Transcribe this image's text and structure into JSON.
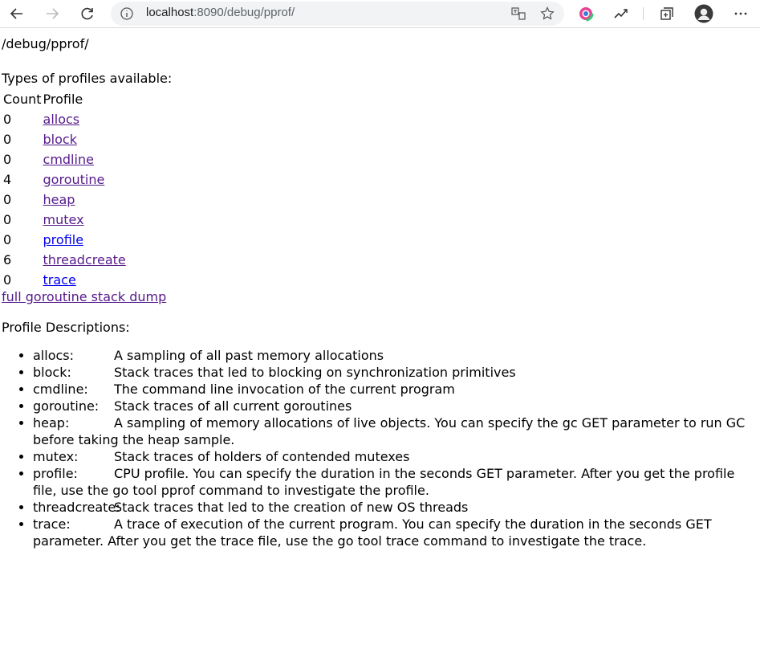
{
  "browser": {
    "url_host": "localhost",
    "url_path": ":8090/debug/pprof/"
  },
  "page": {
    "path_heading": "/debug/pprof/",
    "types_heading": "Types of profiles available:",
    "table": {
      "headers": [
        "Count",
        "Profile"
      ],
      "rows": [
        {
          "count": "0",
          "profile": "allocs"
        },
        {
          "count": "0",
          "profile": "block"
        },
        {
          "count": "0",
          "profile": "cmdline"
        },
        {
          "count": "4",
          "profile": "goroutine"
        },
        {
          "count": "0",
          "profile": "heap"
        },
        {
          "count": "0",
          "profile": "mutex"
        },
        {
          "count": "0",
          "profile": "profile"
        },
        {
          "count": "6",
          "profile": "threadcreate"
        },
        {
          "count": "0",
          "profile": "trace"
        }
      ]
    },
    "full_dump_link": "full goroutine stack dump",
    "descriptions_heading": "Profile Descriptions:",
    "descriptions": [
      {
        "name": "allocs:",
        "text": "A sampling of all past memory allocations"
      },
      {
        "name": "block:",
        "text": "Stack traces that led to blocking on synchronization primitives"
      },
      {
        "name": "cmdline:",
        "text": "The command line invocation of the current program"
      },
      {
        "name": "goroutine:",
        "text": "Stack traces of all current goroutines"
      },
      {
        "name": "heap:",
        "text": "A sampling of memory allocations of live objects. You can specify the gc GET parameter to run GC before taking the heap sample."
      },
      {
        "name": "mutex:",
        "text": "Stack traces of holders of contended mutexes"
      },
      {
        "name": "profile:",
        "text": "CPU profile. You can specify the duration in the seconds GET parameter. After you get the profile file, use the go tool pprof command to investigate the profile."
      },
      {
        "name": "threadcreate:",
        "text": "Stack traces that led to the creation of new OS threads"
      },
      {
        "name": "trace:",
        "text": "A trace of execution of the current program. You can specify the duration in the seconds GET parameter. After you get the trace file, use the go tool trace command to investigate the trace."
      }
    ]
  },
  "colors": {
    "visited_link": "#551a8b",
    "unvisited_link": "#0000ee"
  }
}
